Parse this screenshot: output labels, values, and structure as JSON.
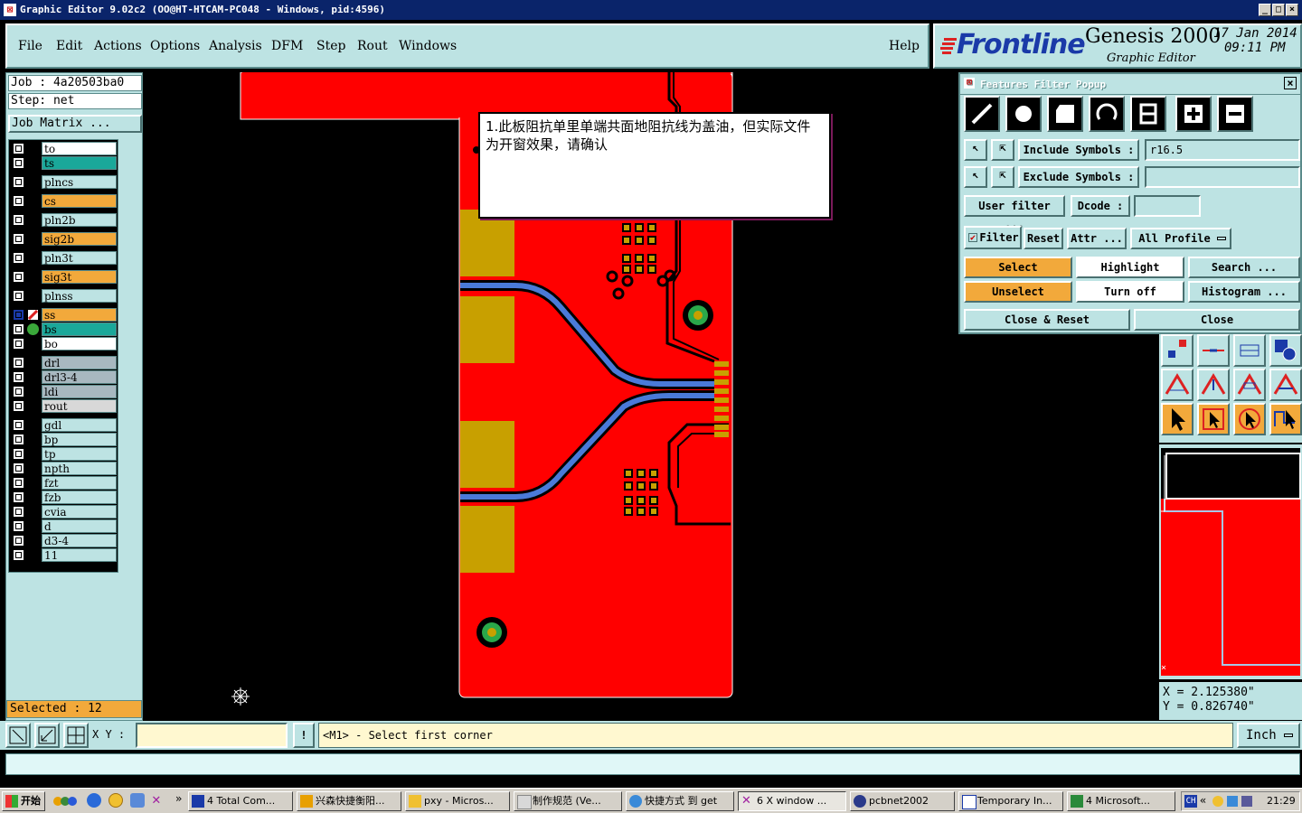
{
  "window": {
    "title": "Graphic Editor 9.02c2  (OO@HT-HTCAM-PC048 - Windows, pid:4596)",
    "min": "_",
    "max": "□",
    "close": "×"
  },
  "menu": [
    "File",
    "Edit",
    "Actions",
    "Options",
    "Analysis",
    "DFM",
    "Step",
    "Rout",
    "Windows"
  ],
  "help": "Help",
  "brand": {
    "logo": "Frontline",
    "product": "Genesis 2000",
    "subtitle": "Graphic Editor",
    "date": "17 Jan 2014",
    "time": "09:11 PM"
  },
  "left": {
    "job": "Job : 4a20503ba0",
    "step": "Step: net",
    "job_matrix": "Job Matrix ...",
    "selected": "Selected : 12"
  },
  "layers": [
    {
      "name": "to",
      "color": "#ffffff"
    },
    {
      "name": "ts",
      "color": "#1aa89a"
    },
    {
      "name": "plncs",
      "color": "#bde3e3"
    },
    {
      "name": "cs",
      "color": "#f2a93b"
    },
    {
      "name": "pln2b",
      "color": "#bde3e3"
    },
    {
      "name": "sig2b",
      "color": "#f2a93b"
    },
    {
      "name": "pln3t",
      "color": "#bde3e3"
    },
    {
      "name": "sig3t",
      "color": "#f2a93b"
    },
    {
      "name": "plnss",
      "color": "#bde3e3"
    },
    {
      "name": "ss",
      "color": "#f2a93b",
      "work": true
    },
    {
      "name": "bs",
      "color": "#1aa89a",
      "display": true
    },
    {
      "name": "bo",
      "color": "#ffffff"
    },
    {
      "name": "drl",
      "color": "#a8b8c0"
    },
    {
      "name": "drl3-4",
      "color": "#a8b8c0"
    },
    {
      "name": "ldi",
      "color": "#a8b8c0"
    },
    {
      "name": "rout",
      "color": "#d8d8d8"
    },
    {
      "name": "gdl",
      "color": "#bde3e3"
    },
    {
      "name": "bp",
      "color": "#bde3e3"
    },
    {
      "name": "tp",
      "color": "#bde3e3"
    },
    {
      "name": "npth",
      "color": "#bde3e3"
    },
    {
      "name": "fzt",
      "color": "#bde3e3"
    },
    {
      "name": "fzb",
      "color": "#bde3e3"
    },
    {
      "name": "cvia",
      "color": "#bde3e3"
    },
    {
      "name": "d",
      "color": "#bde3e3"
    },
    {
      "name": "d3-4",
      "color": "#bde3e3"
    },
    {
      "name": "11",
      "color": "#bde3e3"
    }
  ],
  "note": {
    "text": "1.此板阻抗单里单端共面地阻抗线为盖油，但实际文件为开窗效果，请确认"
  },
  "filter_popup": {
    "title": "Features Filter Popup",
    "include_symbols": "Include Symbols :",
    "include_value": "r16.5",
    "exclude_symbols": "Exclude Symbols :",
    "exclude_value": "",
    "user_filter": "User filter ...",
    "dcode": "Dcode :",
    "dcode_value": "",
    "filter": "Filter",
    "reset": "Reset",
    "attr": "Attr ...",
    "all_profile": "All Profile",
    "select": "Select",
    "highlight": "Highlight",
    "search": "Search ...",
    "unselect": "Unselect",
    "turn_off": "Turn off",
    "histogram": "Histogram ...",
    "close_reset": "Close & Reset",
    "close": "Close"
  },
  "coords": {
    "x": "X = 2.125380\"",
    "y": "Y = 0.826740\""
  },
  "bottom": {
    "xy_label": "X Y :",
    "xy_value": "",
    "prompt": "<M1> - Select first corner",
    "units": "Inch"
  },
  "taskbar": {
    "start": "开始",
    "tasks": [
      "4 Total Com...",
      "兴森快捷衡阳...",
      "pxy - Micros...",
      "制作规范  (Ve...",
      "快捷方式 到 get",
      "6 X window ...",
      "pcbnet2002",
      "Temporary In...",
      "4 Microsoft..."
    ],
    "lang": "CH",
    "clock": "21:29"
  },
  "colors": {
    "panel": "#bde3e3",
    "copper": "#ff0000",
    "gold_pad": "#c8a000",
    "trace_blue": "#4a7ad8",
    "select_yellow": "#f2a93b"
  }
}
